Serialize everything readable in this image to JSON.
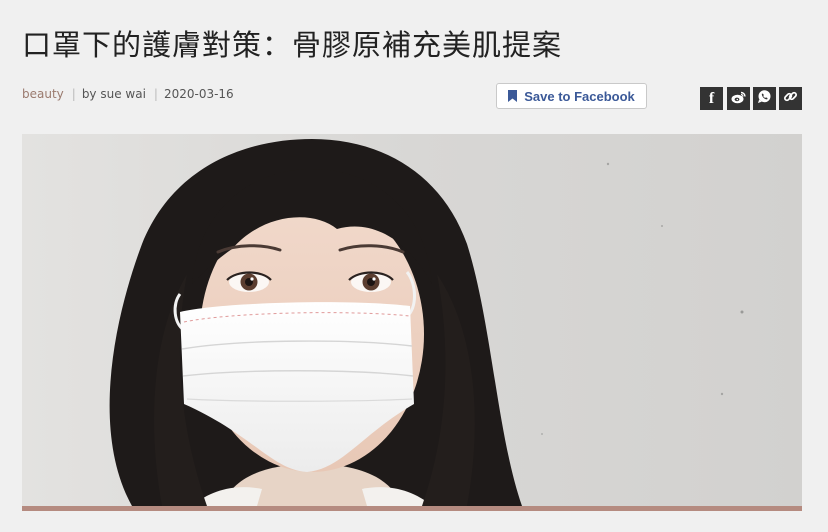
{
  "article": {
    "title": "口罩下的護膚對策：骨膠原補充美肌提案",
    "category": "beauty",
    "author": "by sue wai",
    "date": "2020-03-16"
  },
  "toolbar": {
    "save_label": "Save to Facebook"
  },
  "share": [
    {
      "icon": "facebook-icon",
      "glyph": "f"
    },
    {
      "icon": "weibo-icon"
    },
    {
      "icon": "whatsapp-icon"
    },
    {
      "icon": "link-icon"
    }
  ],
  "hero": {
    "subject": "woman-wearing-surgical-mask-photo"
  },
  "colors": {
    "background": "#f0f0f0",
    "category": "#9a7a6e",
    "facebook_blue": "#3b5998",
    "share_icon_bg": "#333333",
    "accent_bar": "#b58b80"
  }
}
